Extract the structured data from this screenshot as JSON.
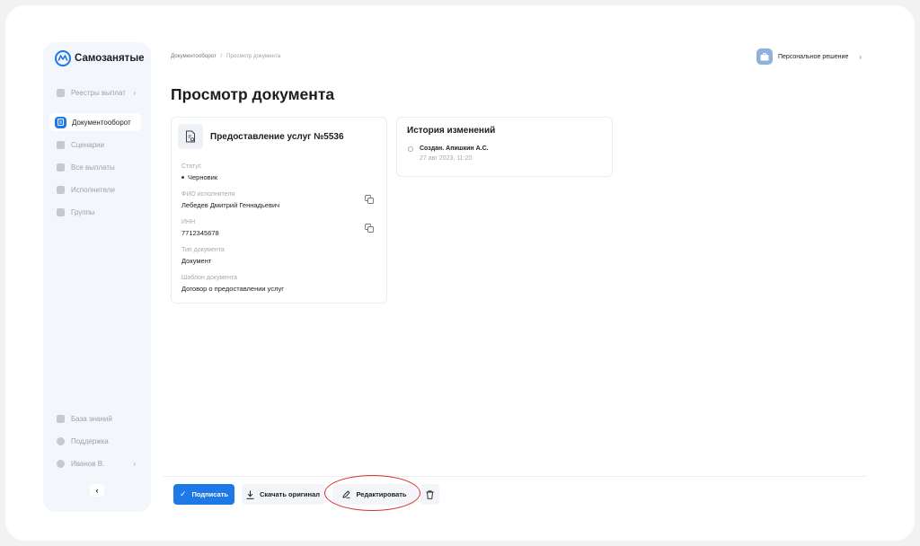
{
  "app": {
    "name": "Самозанятые"
  },
  "sidebar": {
    "items": [
      {
        "label": "Реестры выплат",
        "chevron": "›"
      },
      {
        "label": "Документооборот"
      },
      {
        "label": "Сценарии"
      },
      {
        "label": "Все выплаты"
      },
      {
        "label": "Исполнители"
      },
      {
        "label": "Группы"
      }
    ],
    "bottom": [
      {
        "label": "База знаний"
      },
      {
        "label": "Поддержка"
      },
      {
        "label": "Иванов В.",
        "chevron": "›"
      }
    ],
    "collapse_glyph": "‹"
  },
  "breadcrumb": {
    "parent": "Документооборот",
    "separator": "/",
    "current": "Просмотр документа"
  },
  "header": {
    "plan_label": "Персональное решение",
    "chevron": "›"
  },
  "page": {
    "title": "Просмотр документа"
  },
  "document": {
    "title": "Предоставление услуг №5536",
    "fields": [
      {
        "label": "Статус",
        "value": "Черновик"
      },
      {
        "label": "ФИО исполнителя",
        "value": "Лебедев Дмитрий Геннадьевич"
      },
      {
        "label": "ИНН",
        "value": "7712345678"
      },
      {
        "label": "Тип документа",
        "value": "Документ"
      },
      {
        "label": "Шаблон документа",
        "value": "Договор о предоставлении услуг"
      }
    ]
  },
  "history": {
    "title": "История  изменений",
    "items": [
      {
        "who": "Создан. Апишкин А.С.",
        "when": "27 авг 2023, 11:20"
      }
    ]
  },
  "actions": {
    "sign": "Подписать",
    "download": "Скачать оригинал",
    "edit": "Редактировать",
    "checkmark": "✓"
  },
  "colors": {
    "accent": "#1e78e6",
    "annotation": "#d9302f",
    "sidebar_bg": "#f3f6fa"
  },
  "icons": [
    "logo-icon",
    "document-icon",
    "copy-icon",
    "download-icon",
    "pencil-icon",
    "trash-icon",
    "briefcase-icon"
  ]
}
